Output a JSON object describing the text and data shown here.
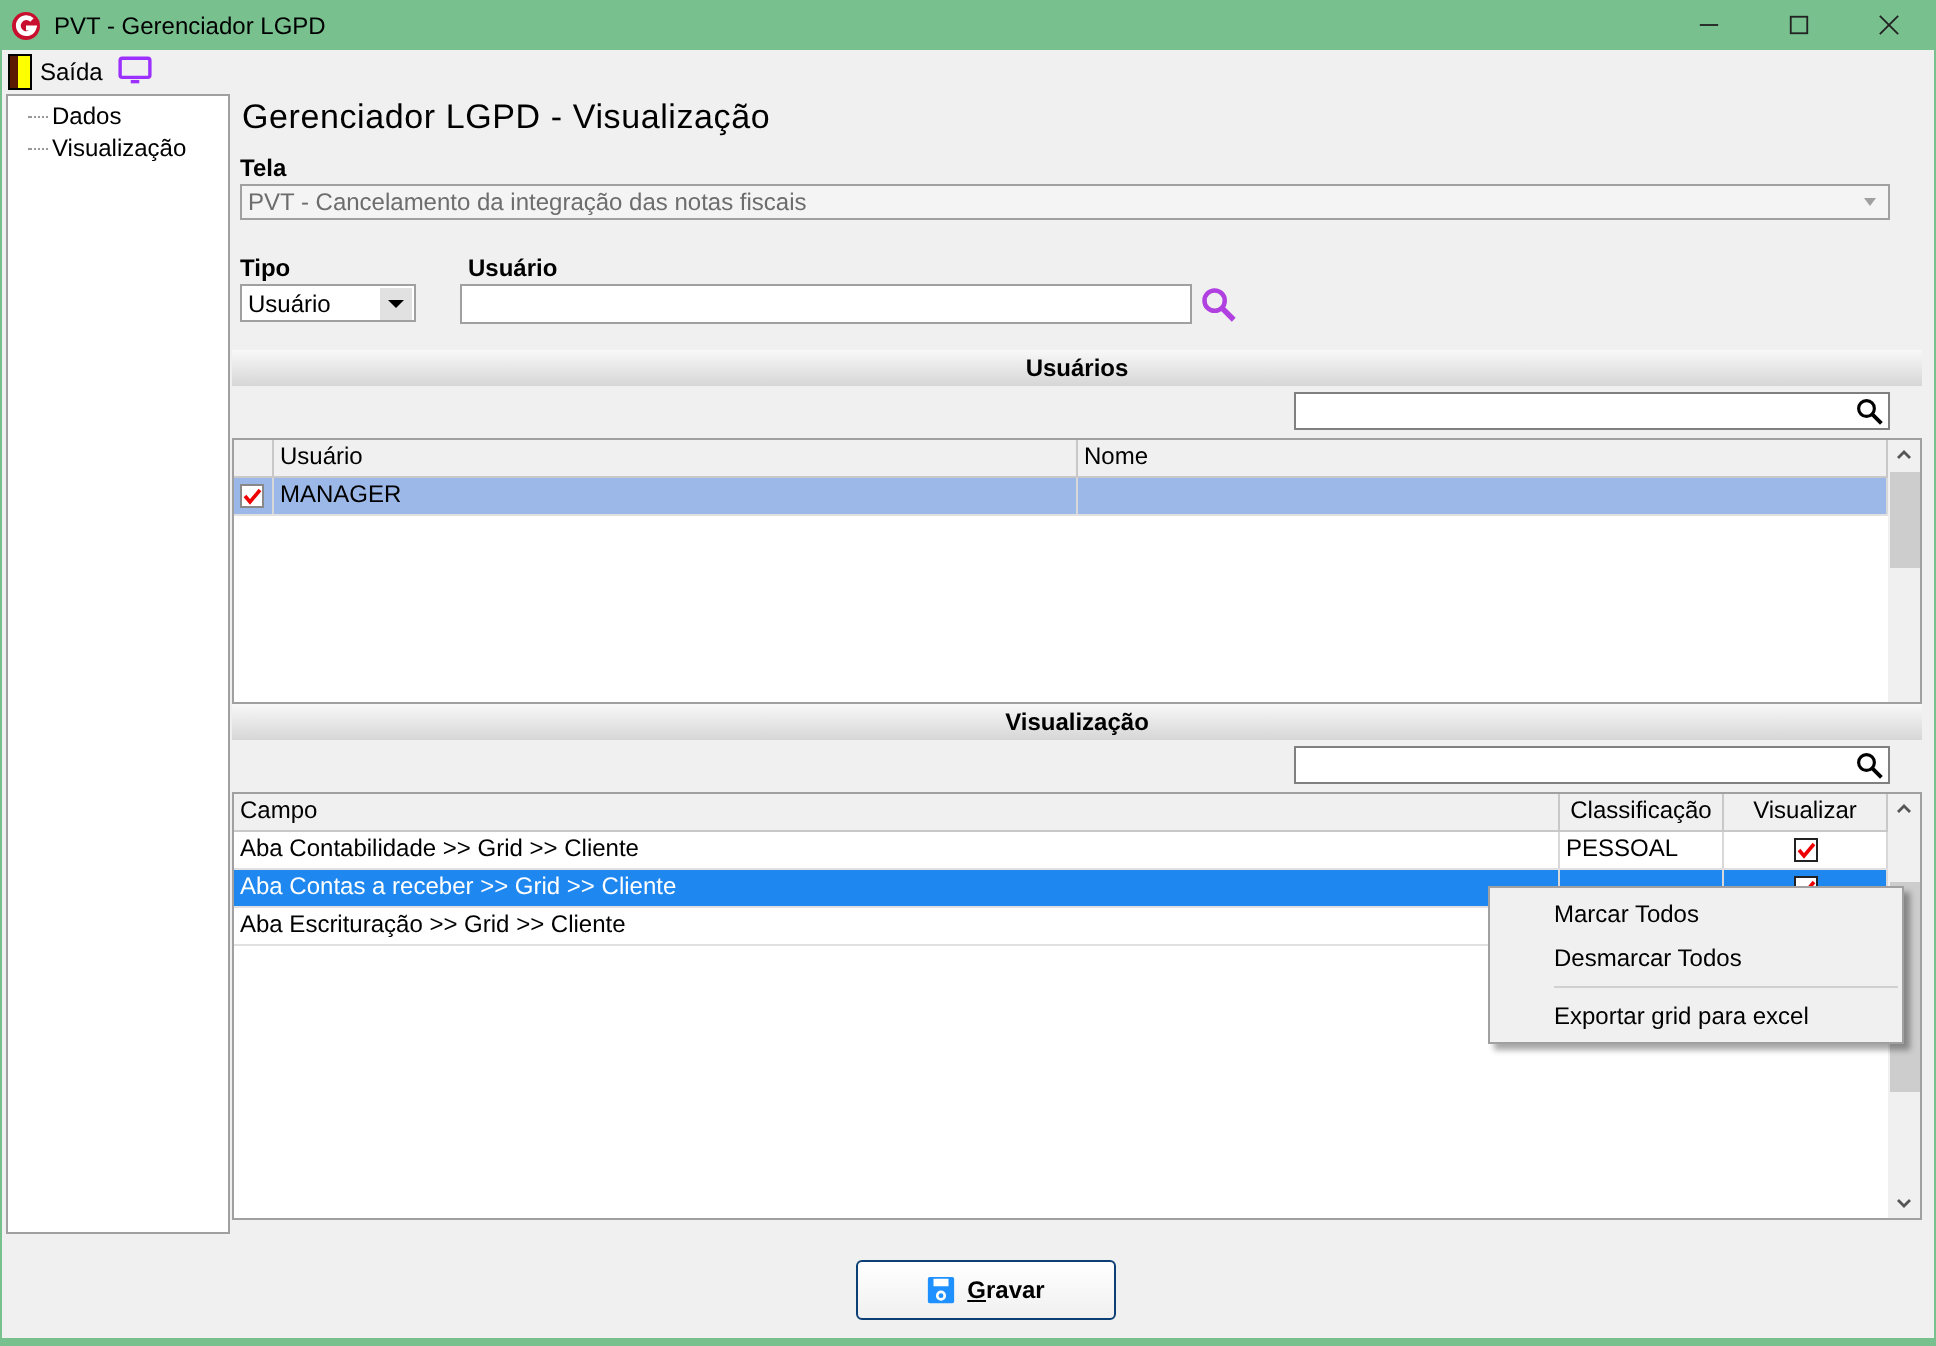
{
  "window": {
    "title": "PVT - Gerenciador LGPD"
  },
  "toolbar": {
    "exit_label": "Saída"
  },
  "tree": {
    "items": [
      {
        "label": "Dados",
        "selected": false
      },
      {
        "label": "Visualização",
        "selected": false
      }
    ]
  },
  "heading": "Gerenciador LGPD - Visualização",
  "tela": {
    "label": "Tela",
    "value": "PVT - Cancelamento da integração das notas fiscais",
    "disabled": true
  },
  "tipo": {
    "label": "Tipo",
    "value": "Usuário"
  },
  "usuario": {
    "label": "Usuário"
  },
  "users_section": {
    "title": "Usuários",
    "columns": [
      "Usuário",
      "Nome"
    ],
    "rows": [
      {
        "checked": true,
        "selected": true,
        "cells": [
          "MANAGER"
        ]
      }
    ]
  },
  "view_section": {
    "title": "Visualização",
    "columns": [
      "Campo",
      "Classificação",
      "Visualizar"
    ],
    "rows": [
      {
        "selected": false,
        "checked": true,
        "cells": [
          "Aba Contabilidade >> Grid >> Cliente",
          "PESSOAL"
        ]
      },
      {
        "selected": true,
        "checked": true,
        "cells": [
          "Aba Contas a receber >> Grid >> Cliente"
        ]
      },
      {
        "selected": false,
        "cells": [
          "Aba Escrituração >> Grid >> Cliente"
        ]
      }
    ]
  },
  "context_menu": {
    "items": [
      {
        "kind": "item",
        "label": "Marcar Todos"
      },
      {
        "kind": "item",
        "label": "Desmarcar Todos"
      },
      {
        "kind": "separator"
      },
      {
        "kind": "item",
        "label": "Exportar grid para excel"
      }
    ]
  },
  "buttons": [
    {
      "label": "Gravar"
    }
  ]
}
